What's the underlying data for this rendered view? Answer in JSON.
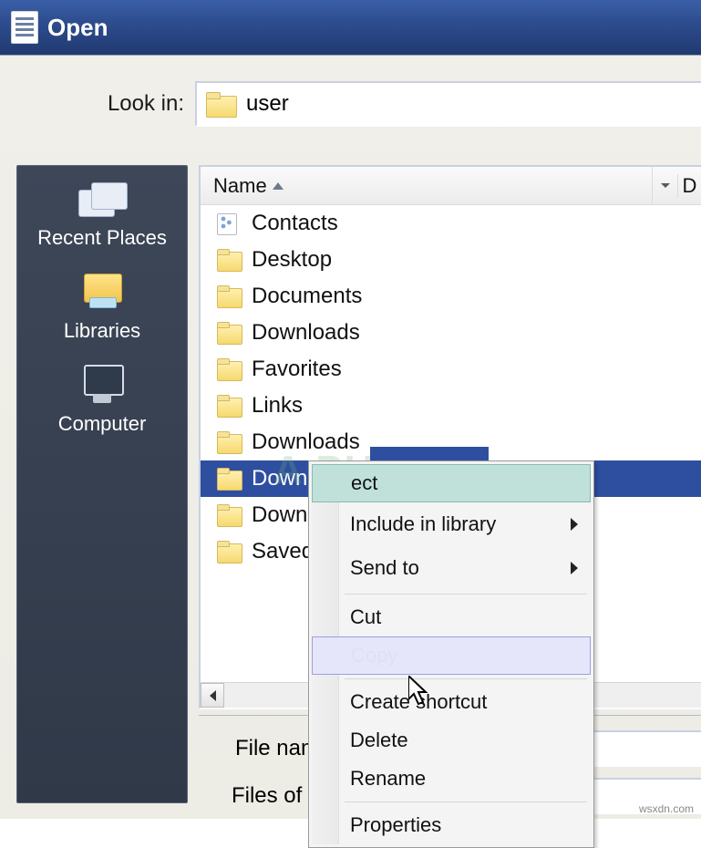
{
  "window": {
    "title": "Open"
  },
  "lookin": {
    "label": "Look in:",
    "value": "user"
  },
  "places": {
    "recent": "Recent Places",
    "libraries": "Libraries",
    "computer": "Computer"
  },
  "columns": {
    "name": "Name",
    "right_initial": "D"
  },
  "files": [
    {
      "name": "Contacts",
      "icon": "contacts"
    },
    {
      "name": "Desktop",
      "icon": "folder"
    },
    {
      "name": "Documents",
      "icon": "folder"
    },
    {
      "name": "Downloads",
      "icon": "folder"
    },
    {
      "name": "Favorites",
      "icon": "folder"
    },
    {
      "name": "Links",
      "icon": "folder"
    },
    {
      "name": "Downloads",
      "icon": "folder"
    },
    {
      "name": "Downloads",
      "icon": "folder",
      "selected": true
    },
    {
      "name": "Downloads",
      "icon": "folder"
    },
    {
      "name": "Saved",
      "icon": "folder",
      "truncated": true
    }
  ],
  "bottom": {
    "file_name_label": "File name:",
    "file_type_label": "Files of typ"
  },
  "context_menu": {
    "items": [
      {
        "label": "ect",
        "state": "highlight-teal",
        "partial": true
      },
      {
        "label": "Include in library",
        "submenu": true
      },
      {
        "label": "Send to",
        "submenu": true
      },
      {
        "sep": true
      },
      {
        "label": "Cut"
      },
      {
        "label": "Copy",
        "state": "highlight-blue",
        "faded": true
      },
      {
        "sep": true
      },
      {
        "label": "Create shortcut"
      },
      {
        "label": "Delete"
      },
      {
        "label": "Rename"
      },
      {
        "sep": true
      },
      {
        "label": "Properties"
      }
    ]
  },
  "watermark": "A  PU  LS",
  "site": "wsxdn.com"
}
